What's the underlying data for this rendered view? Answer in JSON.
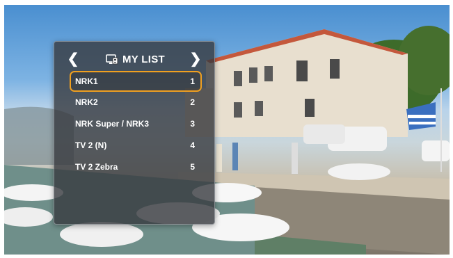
{
  "header": {
    "title": "MY LIST",
    "prev_icon": "chevron-left-icon",
    "next_icon": "chevron-right-icon",
    "list_icon": "tv-list-icon"
  },
  "channels": [
    {
      "name": "NRK1",
      "number": "1",
      "selected": true
    },
    {
      "name": "NRK2",
      "number": "2",
      "selected": false
    },
    {
      "name": "NRK Super / NRK3",
      "number": "3",
      "selected": false
    },
    {
      "name": "TV 2 (N)",
      "number": "4",
      "selected": false
    },
    {
      "name": "TV 2 Zebra",
      "number": "5",
      "selected": false
    }
  ],
  "colors": {
    "highlight": "#f0a020",
    "panel": "#373a3e"
  }
}
